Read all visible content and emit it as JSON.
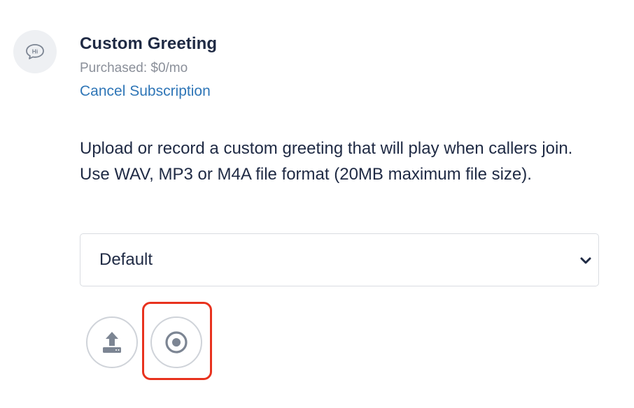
{
  "feature": {
    "title": "Custom Greeting",
    "price": "Purchased: $0/mo",
    "cancel_label": "Cancel Subscription",
    "icon": "speech-bubble-hi-icon",
    "icon_text": "Hi"
  },
  "description": "Upload or record a custom greeting that will play when callers join. Use WAV, MP3 or M4A file format (20MB maximum file size).",
  "greeting_select": {
    "selected": "Default",
    "icon": "chevron-down-icon"
  },
  "actions": {
    "upload_icon": "upload-icon",
    "record_icon": "record-icon"
  },
  "colors": {
    "text": "#1f2a44",
    "link": "#2f76b7",
    "muted": "#8a8f99",
    "highlight": "#e8321e"
  }
}
